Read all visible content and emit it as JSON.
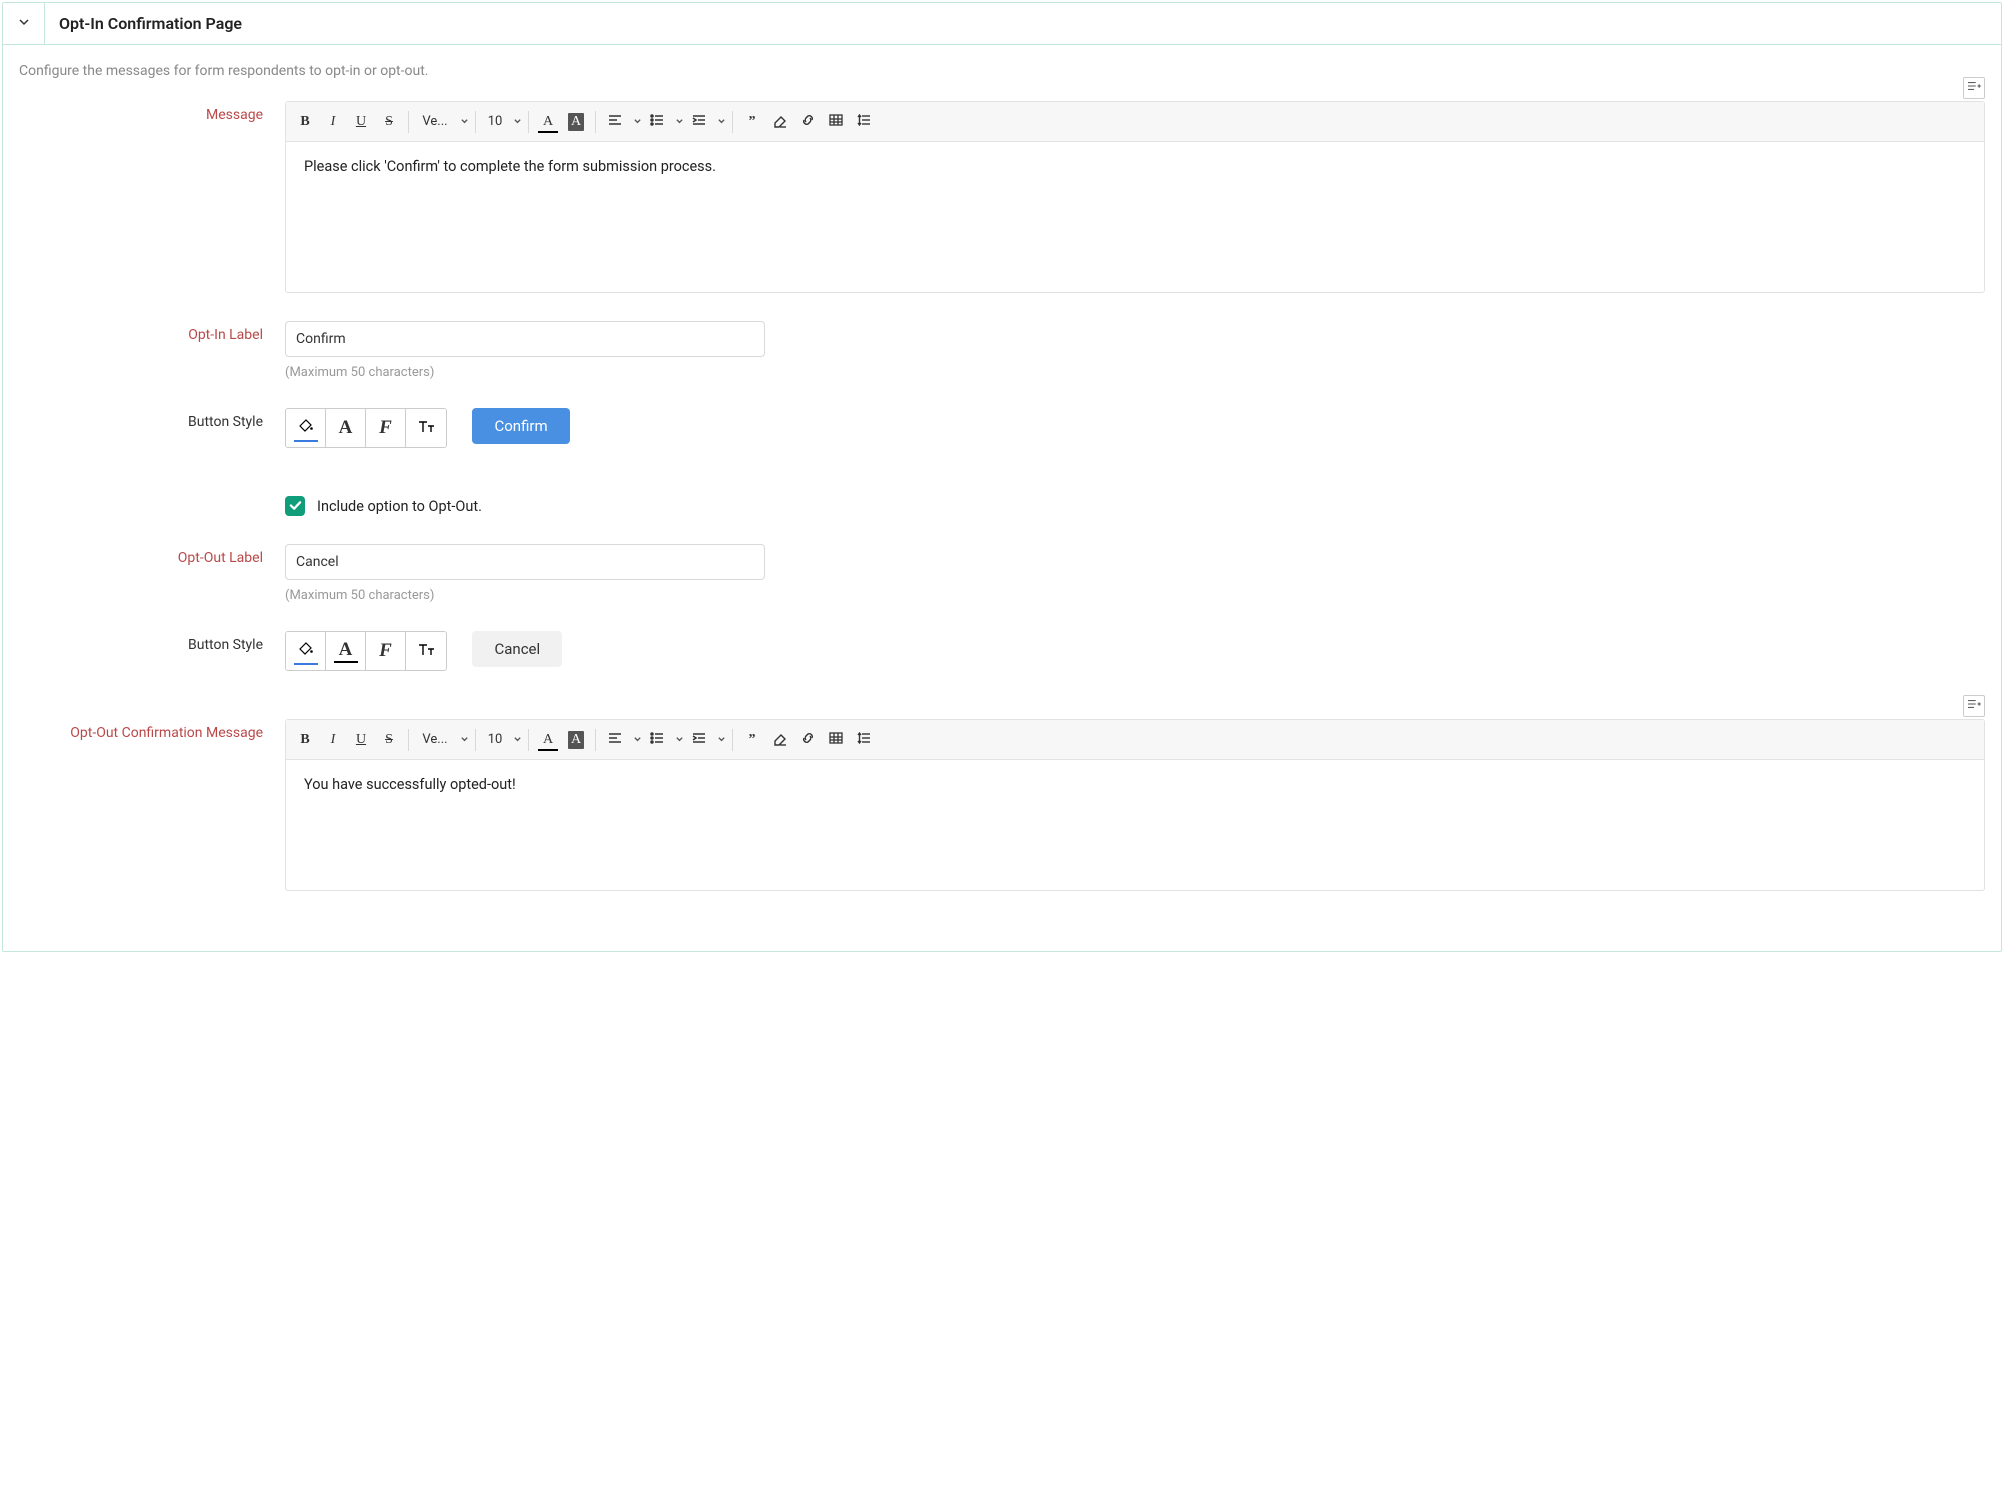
{
  "header": {
    "title": "Opt-In Confirmation Page"
  },
  "intro": "Configure the messages for form respondents to opt-in or opt-out.",
  "labels": {
    "message": "Message",
    "optInLabel": "Opt-In Label",
    "buttonStyle": "Button Style",
    "optOutLabel": "Opt-Out Label",
    "optOutMsg": "Opt-Out Confirmation Message"
  },
  "fields": {
    "messageBody": "Please click 'Confirm' to complete the form submission process.",
    "optInLabel": "Confirm",
    "optInPreview": "Confirm",
    "includeOptOut": "Include option to Opt-Out.",
    "optOutLabel": "Cancel",
    "optOutPreview": "Cancel",
    "optOutBody": "You have successfully opted-out!"
  },
  "hints": {
    "max50": "(Maximum 50 characters)"
  },
  "rte": {
    "fontName": "Ve...",
    "fontSize": "10"
  }
}
